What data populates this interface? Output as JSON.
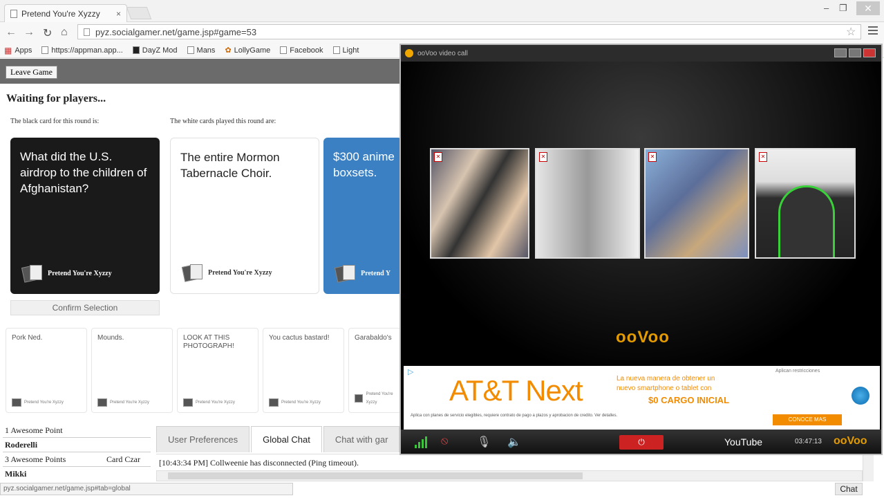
{
  "browser": {
    "tab_title": "Pretend You're Xyzzy",
    "tab_close": "×",
    "url": "pyz.socialgamer.net/game.jsp#game=53",
    "bookmarks": [
      "Apps",
      "https://appman.app...",
      "DayZ Mod",
      "Mans",
      "LollyGame",
      "Facebook",
      "Light"
    ],
    "status_url": "pyz.socialgamer.net/game.jsp#tab=global",
    "icons": [
      "back-arrow-icon",
      "forward-arrow-icon",
      "reload-icon",
      "home-icon",
      "star-icon",
      "menu-icon"
    ]
  },
  "game": {
    "leave_label": "Leave Game",
    "status": "Waiting for players...",
    "black_hint": "The black card for this round is:",
    "white_hint": "The white cards played this round are:",
    "black_card": "What did the U.S. airdrop to the children of Afghanistan?",
    "played_cards": [
      "The entire Mormon Tabernacle Choir.",
      "$300 anime boxsets."
    ],
    "card_brand": "Pretend You're Xyzzy",
    "card_brand_clipped": "Pretend Y",
    "confirm_label": "Confirm Selection",
    "hand": [
      "Pork Ned.",
      "Mounds.",
      "LOOK AT THIS PHOTOGRAPH!",
      "You cactus bastard!",
      "Garabaldo's"
    ],
    "hand_footer": "Pretend You're Xyzzy",
    "scores": [
      {
        "text": "1 Awesome Point",
        "bold": false,
        "czar": ""
      },
      {
        "text": "Roderelli",
        "bold": true,
        "czar": ""
      },
      {
        "text": "3 Awesome Points",
        "bold": false,
        "czar": "Card Czar"
      },
      {
        "text": "Mikki",
        "bold": true,
        "czar": ""
      }
    ],
    "tabs": [
      "User Preferences",
      "Global Chat",
      "Chat with gar"
    ],
    "active_tab": 1,
    "chat_log": "[10:43:34 PM] Collweenie has disconnected (Ping timeout).",
    "chat_button": "Chat"
  },
  "oovoo": {
    "title": "ooVoo video call",
    "brand": "ooVoo",
    "tile_labels": [
      "",
      "",
      "",
      ""
    ],
    "ad": {
      "info_glyph": "▷",
      "title": "AT&T Next",
      "subtitle_lines": [
        "La nueva manera de obtener un",
        "nuevo smartphone o tablet con"
      ],
      "cargo": "$0 CARGO INICIAL",
      "note": "Aplican restricciones",
      "fine_print": "Aplica con planes de servicio elegibles, requiere contrato de pago a plazos y aprobacion de credito. Ver detalles.",
      "cta": "CONOCE MAS"
    },
    "clock": "03:47:13",
    "end_glyph": "⏻",
    "youtube": "YouTube"
  }
}
